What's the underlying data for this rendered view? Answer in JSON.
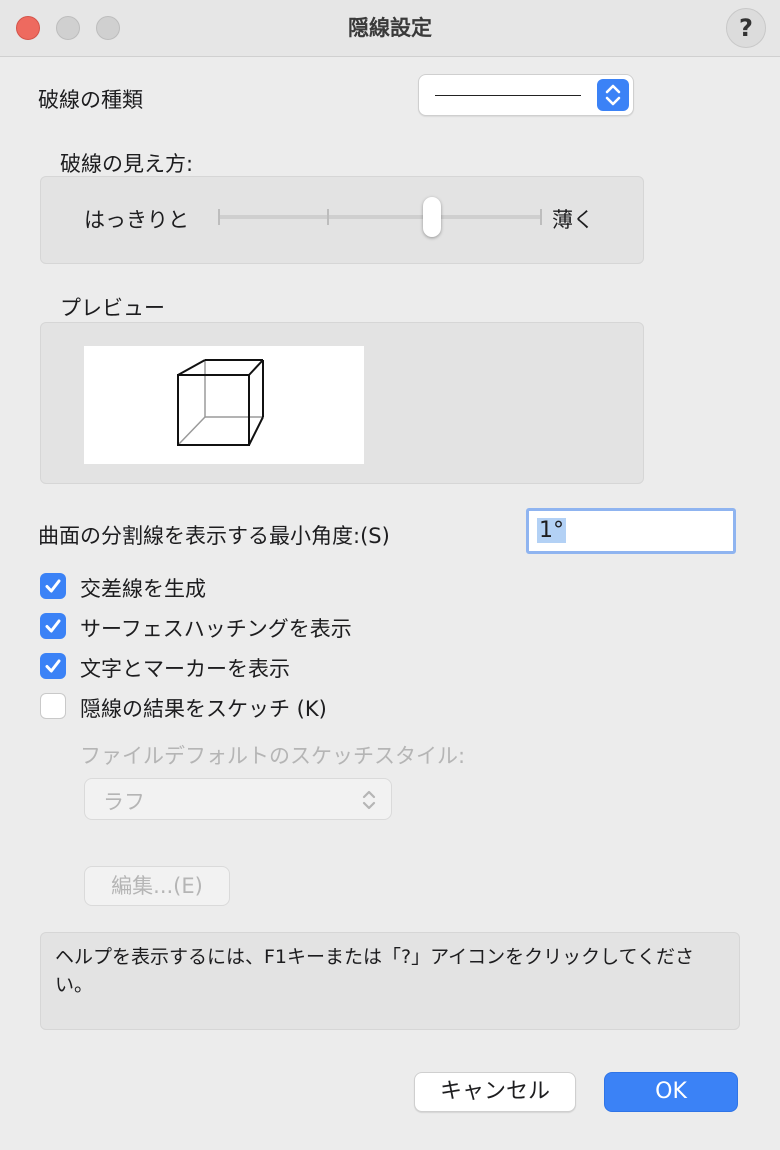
{
  "window": {
    "title": "隠線設定",
    "help_icon": "?"
  },
  "line_type": {
    "label": "破線の種類"
  },
  "appearance": {
    "label": "破線の見え方:",
    "left_label": "はっきりと",
    "right_label": "薄く",
    "slider_value_fraction": 0.65
  },
  "preview": {
    "label": "プレビュー"
  },
  "angle": {
    "label": "曲面の分割線を表示する最小角度:(S)",
    "value": "1°"
  },
  "checkboxes": [
    {
      "label": "交差線を生成",
      "checked": true
    },
    {
      "label": "サーフェスハッチングを表示",
      "checked": true
    },
    {
      "label": "文字とマーカーを表示",
      "checked": true
    },
    {
      "label": "隠線の結果をスケッチ (K)",
      "checked": false
    }
  ],
  "sketch": {
    "style_label": "ファイルデフォルトのスケッチスタイル:",
    "style_value": "ラフ",
    "edit_button": "編集...(E)"
  },
  "help_text": "ヘルプを表示するには、F1キーまたは「?」アイコンをクリックしてください。",
  "buttons": {
    "cancel": "キャンセル",
    "ok": "OK"
  },
  "colors": {
    "accent": "#3b82f6",
    "close": "#ee6a5f"
  },
  "icons": {
    "help": "question-mark-icon",
    "stepper": "chevron-up-down-icon",
    "check": "checkmark-icon"
  }
}
